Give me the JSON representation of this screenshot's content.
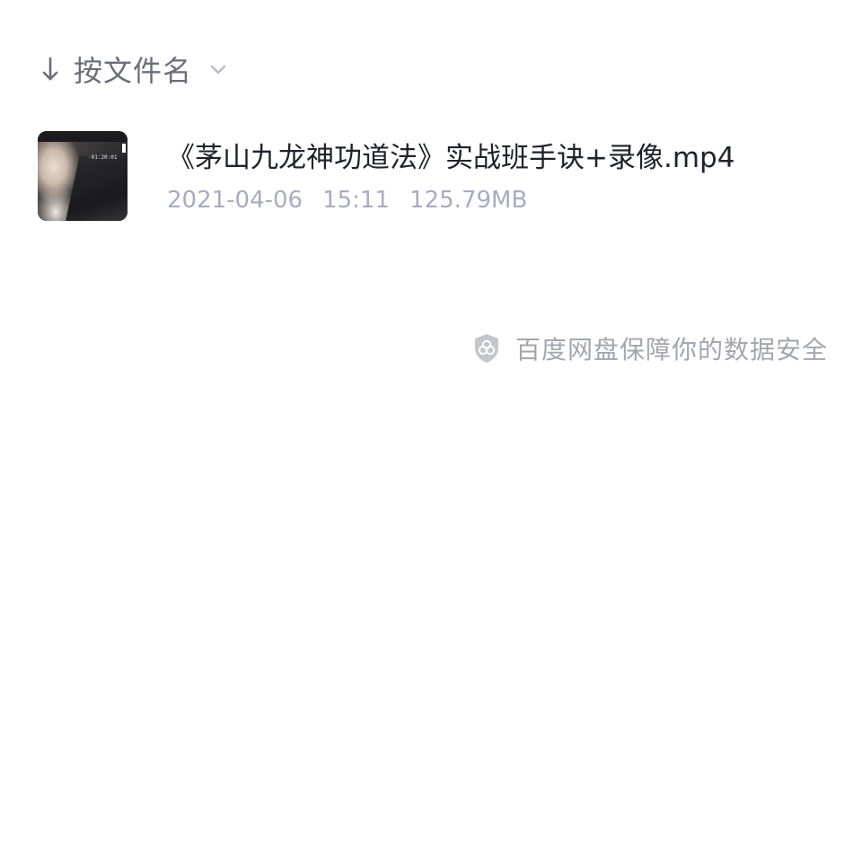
{
  "sort": {
    "arrow_icon": "arrow-down-icon",
    "label": "按文件名",
    "chevron_icon": "chevron-down-icon"
  },
  "files": [
    {
      "thumbnail_icon": "video-thumbnail",
      "thumbnail_text": [
        "·01:20:01"
      ],
      "name": "《茅山九龙神功道法》实战班手诀+录像.mp4",
      "date": "2021-04-06",
      "time": "15:11",
      "size": "125.79MB"
    }
  ],
  "footer": {
    "icon": "shield-icon",
    "text": "百度网盘保障你的数据安全"
  },
  "colors": {
    "background": "#ffffff",
    "title_text": "#1f2329",
    "meta_text": "#a9acbf",
    "muted_text": "#a3a6ad",
    "sort_text": "#6b6e78"
  }
}
